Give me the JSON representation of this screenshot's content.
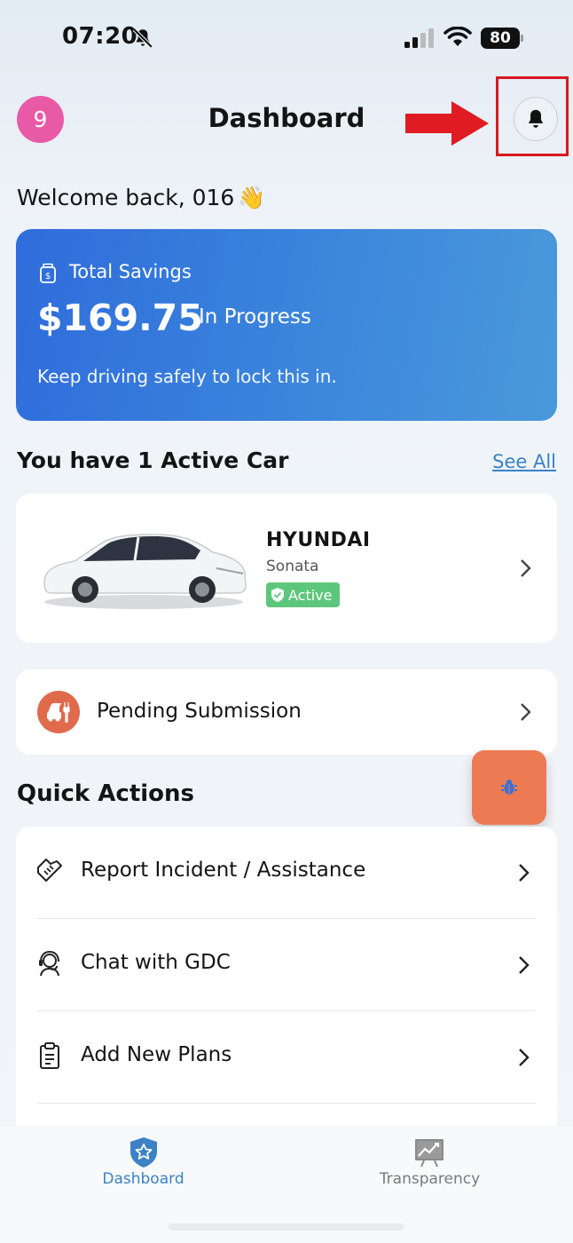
{
  "status_bar": {
    "time": "07:20",
    "battery": "80",
    "icons": [
      "mute-icon",
      "signal-icon",
      "wifi-icon",
      "battery-icon"
    ]
  },
  "header": {
    "avatar_text": "9",
    "title": "Dashboard",
    "bell_icon": "bell-icon",
    "annotation_color": "#d71920"
  },
  "welcome": {
    "text": "Welcome back, 016",
    "emoji": "👋"
  },
  "savings": {
    "label": "Total Savings",
    "amount": "$169.75",
    "status": "In Progress",
    "note": "Keep driving safely to lock this in."
  },
  "cars": {
    "heading": "You have 1 Active Car",
    "see_all": "See All",
    "items": [
      {
        "make": "HYUNDAI",
        "model": "Sonata",
        "status": "Active"
      }
    ]
  },
  "pending": {
    "label": "Pending Submission"
  },
  "quick_actions": {
    "heading": "Quick Actions",
    "items": [
      {
        "label": "Report Incident / Assistance",
        "icon": "handshake-icon"
      },
      {
        "label": "Chat with GDC",
        "icon": "support-agent-icon"
      },
      {
        "label": "Add New Plans",
        "icon": "clipboard-icon"
      }
    ]
  },
  "tabs": [
    {
      "label": "Dashboard",
      "icon": "shield-star-icon",
      "active": true
    },
    {
      "label": "Transparency",
      "icon": "chart-board-icon",
      "active": false
    }
  ],
  "colors": {
    "accent": "#3c82c4",
    "card_gradient_start": "#2f6cdc",
    "card_gradient_end": "#4a99db",
    "fab": "#ec7b54",
    "badge_active": "#5cc77b",
    "avatar": "#e85aa6"
  }
}
